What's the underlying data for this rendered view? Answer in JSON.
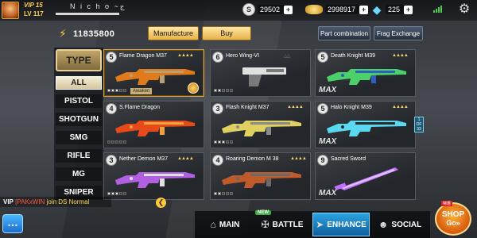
{
  "player": {
    "vip": "VIP 15",
    "level": "LV 117",
    "name": "N i c h o ~⁣ج"
  },
  "resources": {
    "silver": "29502",
    "gold": "2998917",
    "diamond": "225"
  },
  "gp": {
    "amount": "11835800"
  },
  "actions": {
    "manufacture": "Manufacture",
    "buy": "Buy",
    "part_combination": "Part combination",
    "frag_exchange": "Frag Exchange"
  },
  "type_menu": {
    "header": "TYPE",
    "items": [
      "ALL",
      "PISTOL",
      "SHOTGUN",
      "SMG",
      "RIFLE",
      "MG",
      "SNIPER"
    ]
  },
  "weapons": [
    {
      "level": "5",
      "name": "Flame Dragon M37",
      "stars": "▲▲▲▲",
      "status": "Awaken",
      "colors": [
        "#e07a1a",
        "#b8a070"
      ]
    },
    {
      "level": "6",
      "name": "Hero Wing-VI",
      "stars": "△△",
      "status": "",
      "colors": [
        "#e0e0e0",
        "#7a7a7a"
      ]
    },
    {
      "level": "5",
      "name": "Death Knight M39",
      "stars": "▲▲▲▲",
      "status": "MAX",
      "colors": [
        "#4bd06a",
        "#2c5fc0"
      ]
    },
    {
      "level": "4",
      "name": "S.Flame Dragon",
      "stars": "",
      "status": "",
      "colors": [
        "#e64a1a",
        "#f0a040"
      ]
    },
    {
      "level": "3",
      "name": "Flash Knight M37",
      "stars": "▲▲▲▲",
      "status": "",
      "colors": [
        "#e0d060",
        "#8a8a8a"
      ]
    },
    {
      "level": "5",
      "name": "Halo Knight M39",
      "stars": "▲▲▲▲",
      "status": "MAX",
      "colors": [
        "#5ad8f0",
        "#2a2a2a"
      ]
    },
    {
      "level": "3",
      "name": "Nether Demon M37",
      "stars": "▲▲▲▲",
      "status": "",
      "colors": [
        "#b060e0",
        "#e0e0e0"
      ]
    },
    {
      "level": "4",
      "name": "Roaring Demon M 38",
      "stars": "▲▲▲▲",
      "status": "",
      "colors": [
        "#c05a2a",
        "#6a6a6a"
      ]
    },
    {
      "level": "9",
      "name": "Sacred Sword",
      "stars": "",
      "status": "MAX",
      "colors": [
        "#c070ff",
        "#f0e0ff"
      ]
    }
  ],
  "side_counter": "1 OF 33",
  "chat": {
    "vip": "VIP",
    "guild": "[PAKxWIN",
    "msg": "join DS Normal"
  },
  "nav": {
    "main": "MAIN",
    "battle": "BATTLE",
    "enhance": "ENHANCE",
    "social": "SOCIAL",
    "new_tag": "NEW"
  },
  "shop": {
    "label": "SHOP",
    "go": "Go»",
    "tag": "特惠"
  },
  "colors": {
    "gold_accent": "#ffd24a",
    "enhance_active": "#2aa3e0",
    "shop_orange": "#d65a0c"
  }
}
